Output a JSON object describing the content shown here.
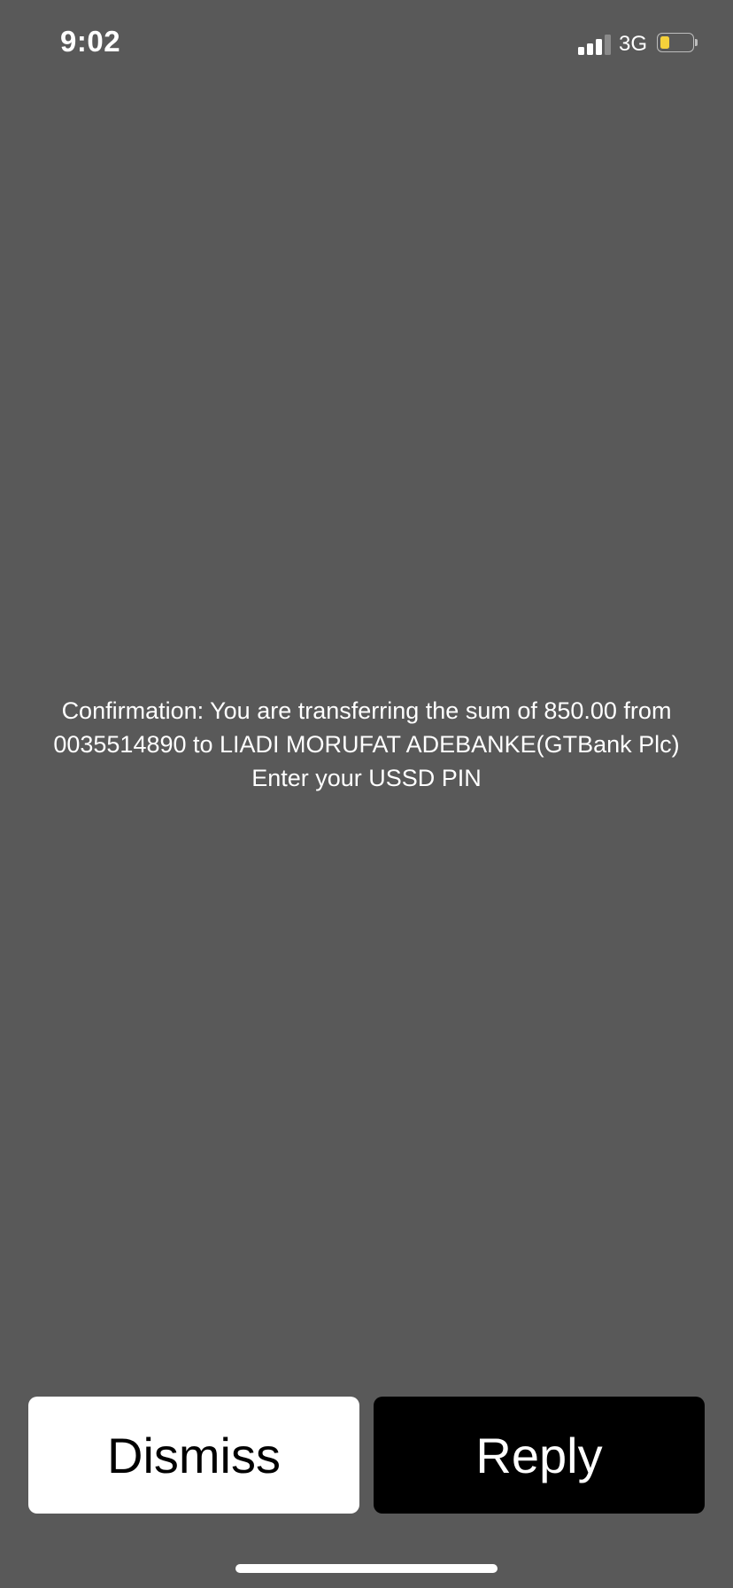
{
  "status_bar": {
    "time": "9:02",
    "network": "3G",
    "signal_bars_active": 3,
    "signal_bars_total": 4,
    "battery_level_fraction": 0.3,
    "battery_color": "#f5d13b"
  },
  "dialog": {
    "message_lines": [
      "Confirmation: You are transferring the sum of 850.00 from",
      "0035514890 to LIADI MORUFAT ADEBANKE(GTBank Plc)",
      "Enter your USSD PIN"
    ]
  },
  "actions": {
    "dismiss_label": "Dismiss",
    "reply_label": "Reply"
  },
  "colors": {
    "background": "#595959",
    "dismiss_bg": "#ffffff",
    "reply_bg": "#000000"
  }
}
